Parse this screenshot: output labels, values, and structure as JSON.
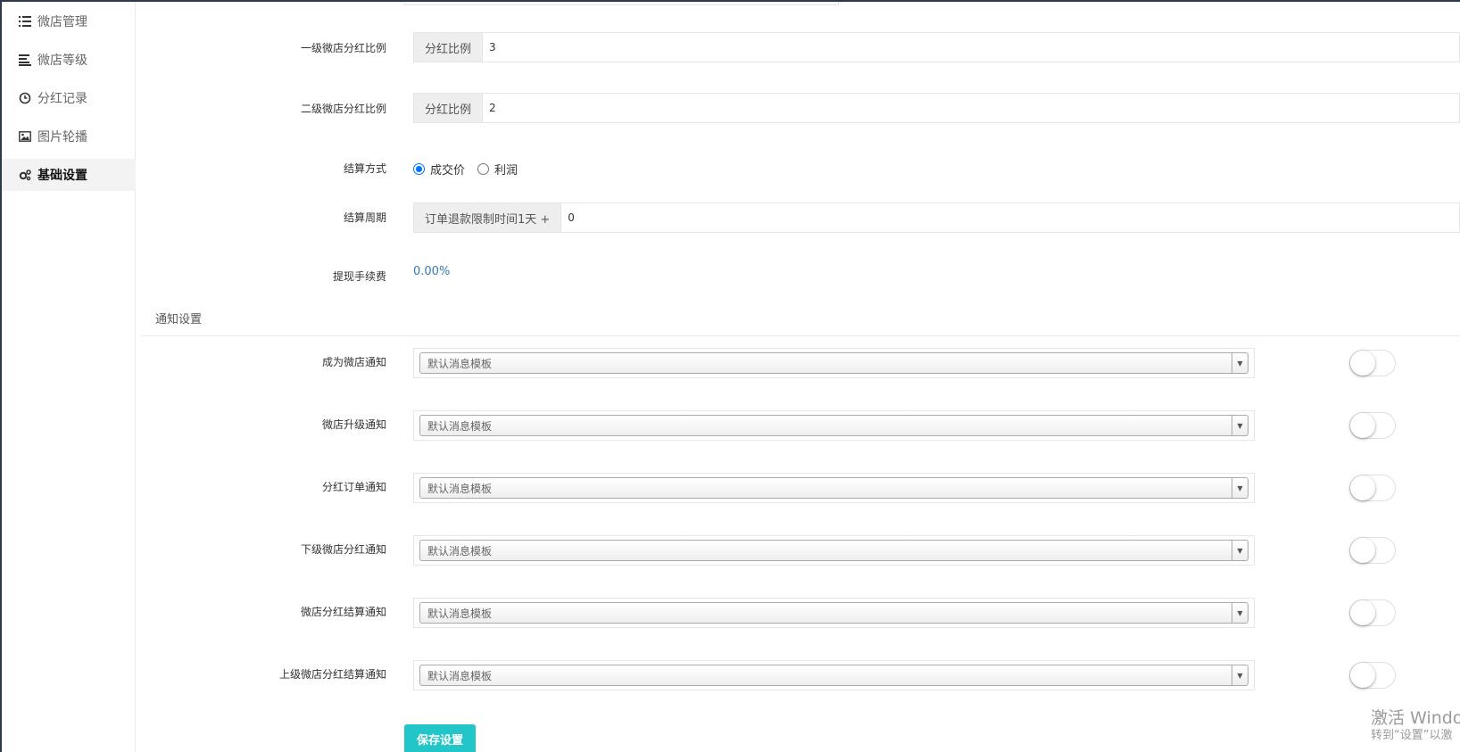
{
  "sidebar": {
    "items": [
      {
        "label": "微店管理",
        "icon": "list-icon"
      },
      {
        "label": "微店等级",
        "icon": "align-left-icon"
      },
      {
        "label": "分红记录",
        "icon": "clock-icon"
      },
      {
        "label": "图片轮播",
        "icon": "image-icon"
      },
      {
        "label": "基础设置",
        "icon": "gears-icon",
        "active": true
      }
    ]
  },
  "form": {
    "level1": {
      "label": "一级微店分红比例",
      "addon": "分红比例",
      "value": "3"
    },
    "level2": {
      "label": "二级微店分红比例",
      "addon": "分红比例",
      "value": "2"
    },
    "settle_method": {
      "label": "结算方式",
      "options": [
        "成交价",
        "利润"
      ],
      "selected": "成交价"
    },
    "settle_period": {
      "label": "结算周期",
      "addon": "订单退款限制时间1天 +",
      "value": "0"
    },
    "withdraw_fee": {
      "label": "提现手续费",
      "value": "0.00%"
    }
  },
  "notify": {
    "section_title": "通知设置",
    "items": [
      {
        "label": "成为微店通知",
        "placeholder": "默认消息模板",
        "enabled": false
      },
      {
        "label": "微店升级通知",
        "placeholder": "默认消息模板",
        "enabled": false
      },
      {
        "label": "分红订单通知",
        "placeholder": "默认消息模板",
        "enabled": false
      },
      {
        "label": "下级微店分红通知",
        "placeholder": "默认消息模板",
        "enabled": false
      },
      {
        "label": "微店分红结算通知",
        "placeholder": "默认消息模板",
        "enabled": false
      },
      {
        "label": "上级微店分红结算通知",
        "placeholder": "默认消息模板",
        "enabled": false
      }
    ]
  },
  "save_label": "保存设置",
  "watermark": {
    "line1": "激活 Windo",
    "line2": "转到“设置”以激"
  },
  "colors": {
    "accent": "#23c6c8",
    "link": "#337ab7",
    "radio": "#0075ff"
  }
}
